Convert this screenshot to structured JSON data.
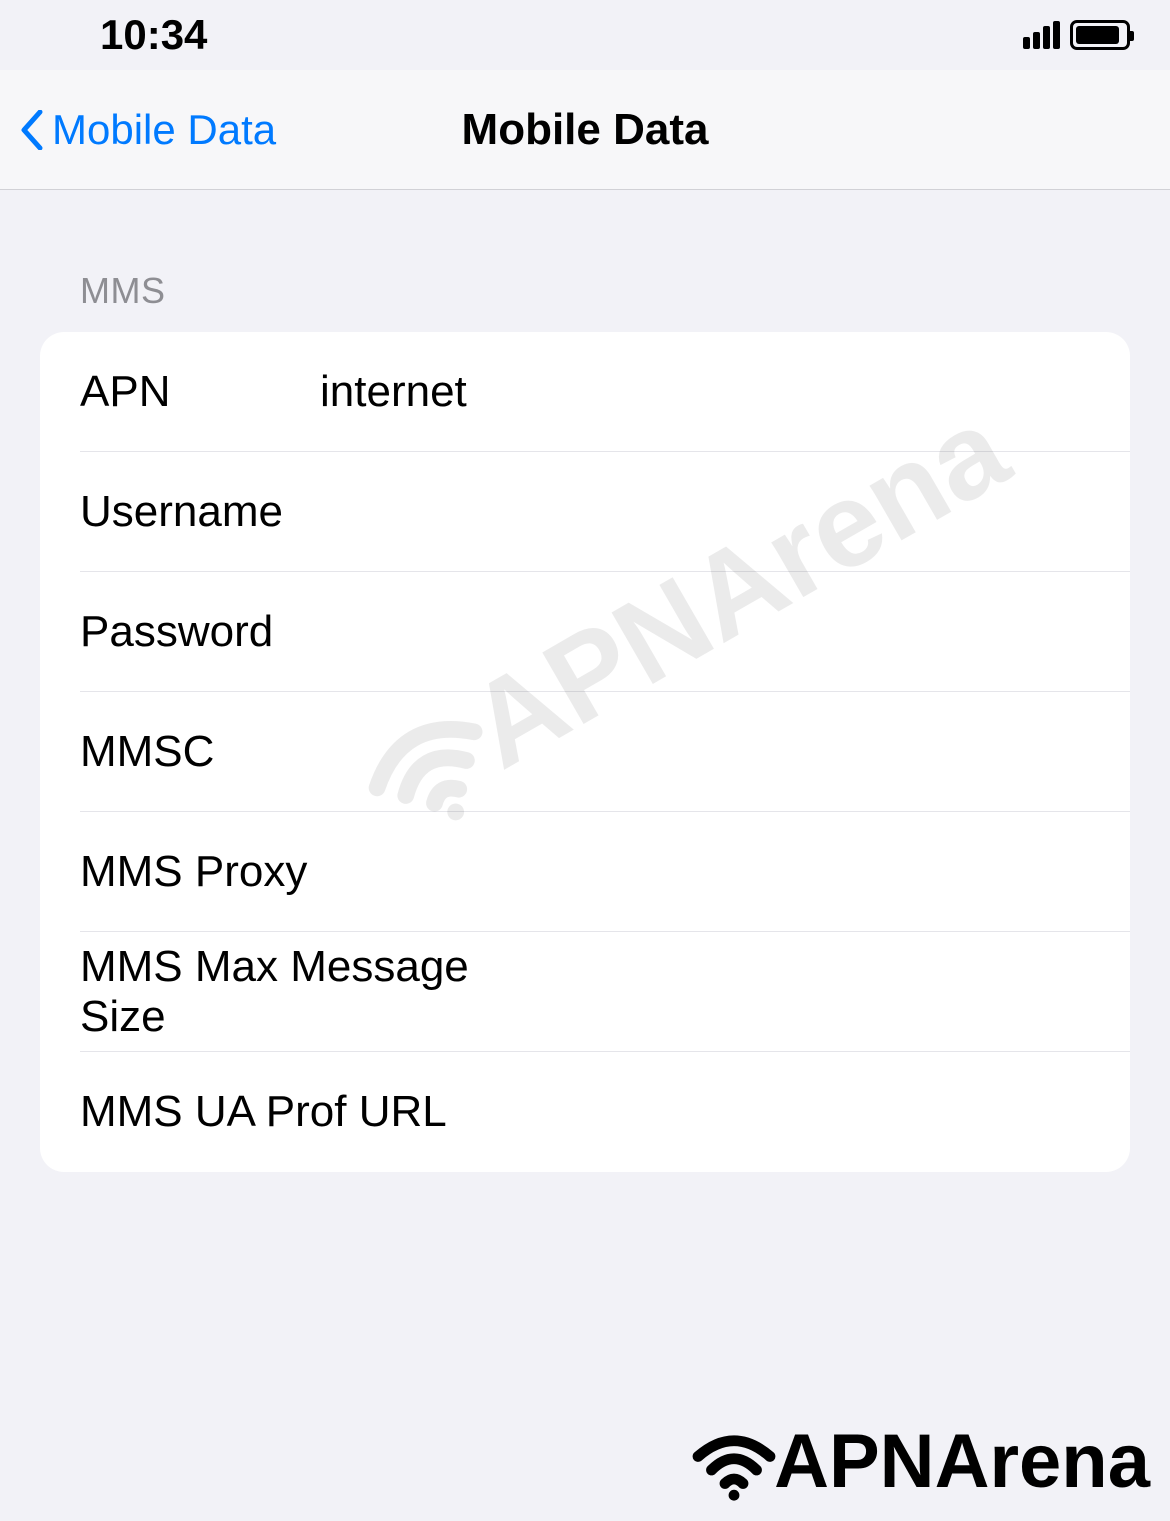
{
  "statusbar": {
    "time": "10:34"
  },
  "navbar": {
    "back_label": "Mobile Data",
    "title": "Mobile Data"
  },
  "section": {
    "header": "MMS"
  },
  "fields": {
    "apn": {
      "label": "APN",
      "value": "internet"
    },
    "username": {
      "label": "Username",
      "value": ""
    },
    "password": {
      "label": "Password",
      "value": ""
    },
    "mmsc": {
      "label": "MMSC",
      "value": ""
    },
    "mms_proxy": {
      "label": "MMS Proxy",
      "value": ""
    },
    "mms_max": {
      "label": "MMS Max Message Size",
      "value": ""
    },
    "mms_ua": {
      "label": "MMS UA Prof URL",
      "value": ""
    }
  },
  "watermark": {
    "text": "APNArena"
  },
  "footer": {
    "text": "APNArena"
  }
}
